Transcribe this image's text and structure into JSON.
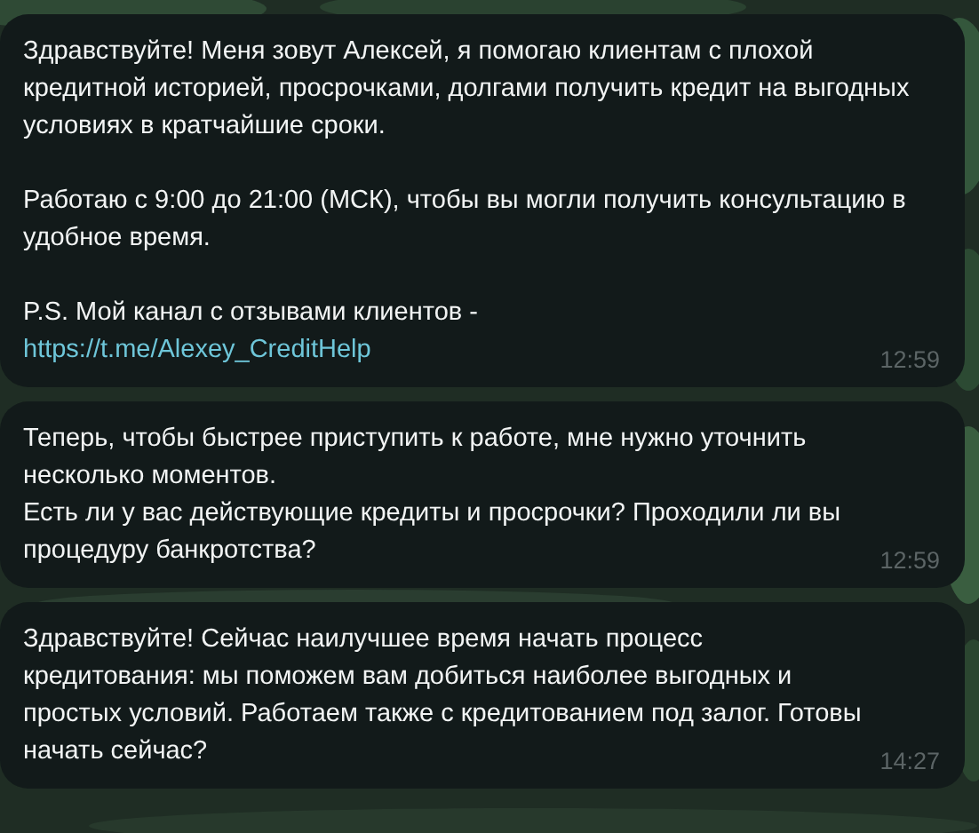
{
  "messages": [
    {
      "time": "12:59",
      "parts": [
        {
          "kind": "text",
          "text": "Здравствуйте! Меня зовут Алексей, я помогаю клиентам с плохой кредитной историей, просрочками, долгами получить кредит на выгодных условиях в кратчайшие сроки."
        },
        {
          "kind": "text",
          "text": "Работаю с 9:00 до 21:00 (МСК), чтобы вы могли получить консультацию в удобное время."
        },
        {
          "kind": "text",
          "text": "P.S. Мой канал с отзывами клиентов -"
        },
        {
          "kind": "link",
          "text": "https://t.me/Alexey_CreditHelp"
        }
      ]
    },
    {
      "time": "12:59",
      "parts": [
        {
          "kind": "text",
          "text": "Теперь, чтобы быстрее приступить к работе, мне нужно уточнить несколько моментов.\nЕсть ли у вас действующие кредиты и просрочки? Проходили ли вы процедуру банкротства?"
        }
      ]
    },
    {
      "time": "14:27",
      "parts": [
        {
          "kind": "text",
          "text": "Здравствуйте! Сейчас наилучшее время начать процесс кредитования: мы поможем вам добиться наиболее выгодных и простых условий. Работаем также с кредитованием под залог. Готовы начать сейчас?"
        }
      ]
    }
  ]
}
